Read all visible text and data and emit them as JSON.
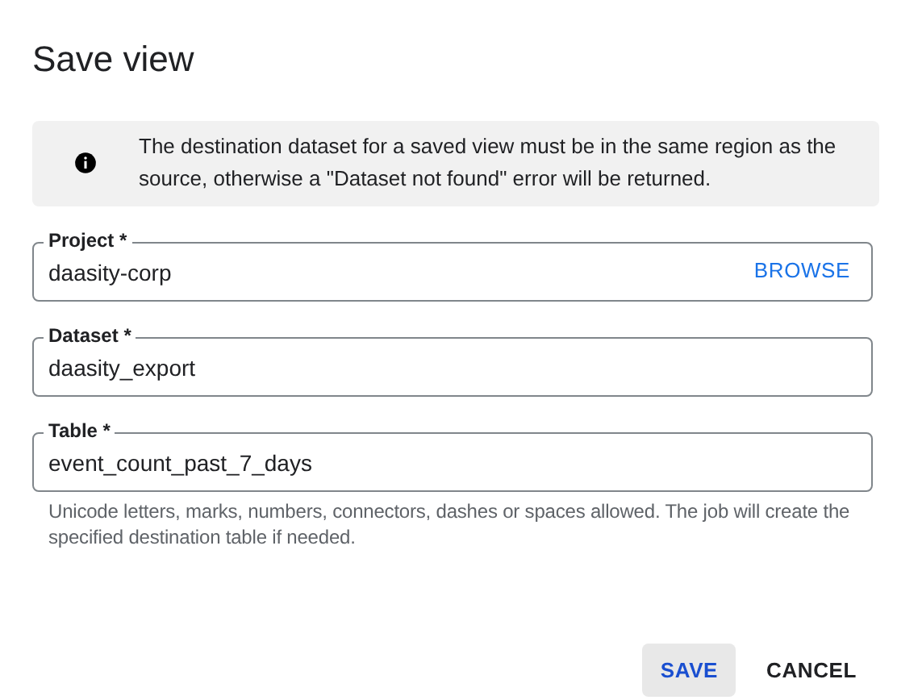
{
  "dialog": {
    "title": "Save view"
  },
  "notice": {
    "text": "The destination dataset for a saved view must be in the same region as the source, otherwise a \"Dataset not found\" error will be returned."
  },
  "fields": [
    {
      "label": "Project *",
      "value": "daasity-corp",
      "action": "BROWSE"
    },
    {
      "label": "Dataset *",
      "value": "daasity_export"
    },
    {
      "label": "Table *",
      "value": "event_count_past_7_days",
      "hint": "Unicode letters, marks, numbers, connectors, dashes or spaces allowed. The job will create the specified destination table if needed."
    }
  ],
  "buttons": [
    {
      "label": "SAVE",
      "kind": "primary",
      "hovered": true
    },
    {
      "label": "CANCEL",
      "kind": "plain",
      "hovered": false
    }
  ]
}
